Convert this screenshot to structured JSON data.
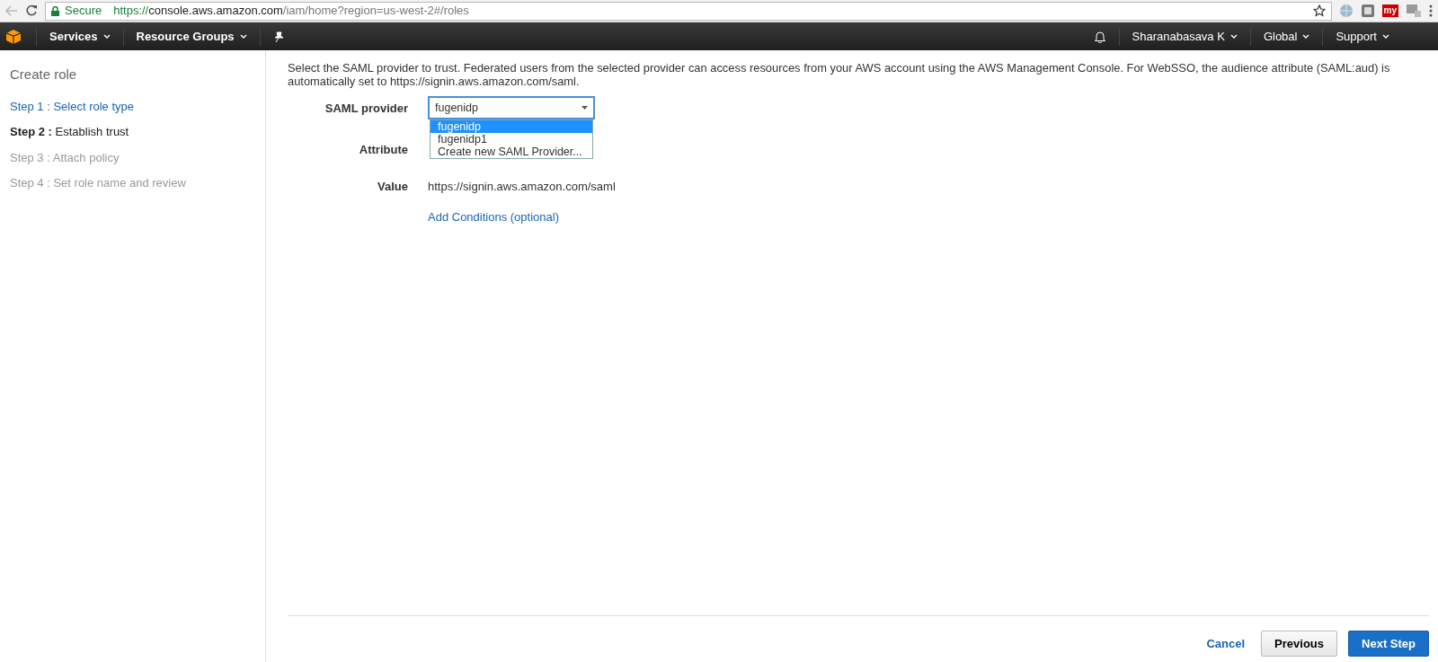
{
  "browser": {
    "secure_label": "Secure",
    "url_scheme": "https://",
    "url_host": "console.aws.amazon.com",
    "url_path": "/iam/home?region=us-west-2#/roles",
    "extensions": [
      {
        "kind": "globe"
      },
      {
        "kind": "square"
      },
      {
        "kind": "badge",
        "text": "my"
      },
      {
        "kind": "phone"
      }
    ]
  },
  "navbar": {
    "left": [
      {
        "label": "Services"
      },
      {
        "label": "Resource Groups"
      }
    ],
    "right": [
      {
        "label": "Sharanabasava K"
      },
      {
        "label": "Global"
      },
      {
        "label": "Support"
      }
    ]
  },
  "sidebar": {
    "title": "Create role",
    "steps": [
      {
        "prefix": "Step 1 :",
        "label": "Select role type",
        "kind": "done"
      },
      {
        "prefix": "Step 2 :",
        "label": "Establish trust",
        "kind": "current"
      },
      {
        "prefix": "Step 3 :",
        "label": "Attach policy",
        "kind": "pending"
      },
      {
        "prefix": "Step 4 :",
        "label": "Set role name and review",
        "kind": "pending"
      }
    ]
  },
  "form": {
    "intro": "Select the SAML provider to trust. Federated users from the selected provider can access resources from your AWS account using the AWS Management Console. For WebSSO, the audience attribute (SAML:aud) is automatically set to https://signin.aws.amazon.com/saml.",
    "saml_provider": {
      "label": "SAML provider",
      "value": "fugenidp",
      "expanded": true,
      "options": [
        {
          "label": "fugenidp",
          "selected": true
        },
        {
          "label": "fugenidp1",
          "selected": false
        },
        {
          "label": "Create new SAML Provider...",
          "selected": false
        }
      ]
    },
    "attribute": {
      "label": "Attribute"
    },
    "value": {
      "label": "Value",
      "text": "https://signin.aws.amazon.com/saml"
    },
    "add_conditions": "Add Conditions (optional)"
  },
  "footer": {
    "cancel": "Cancel",
    "previous": "Previous",
    "next": "Next Step"
  }
}
